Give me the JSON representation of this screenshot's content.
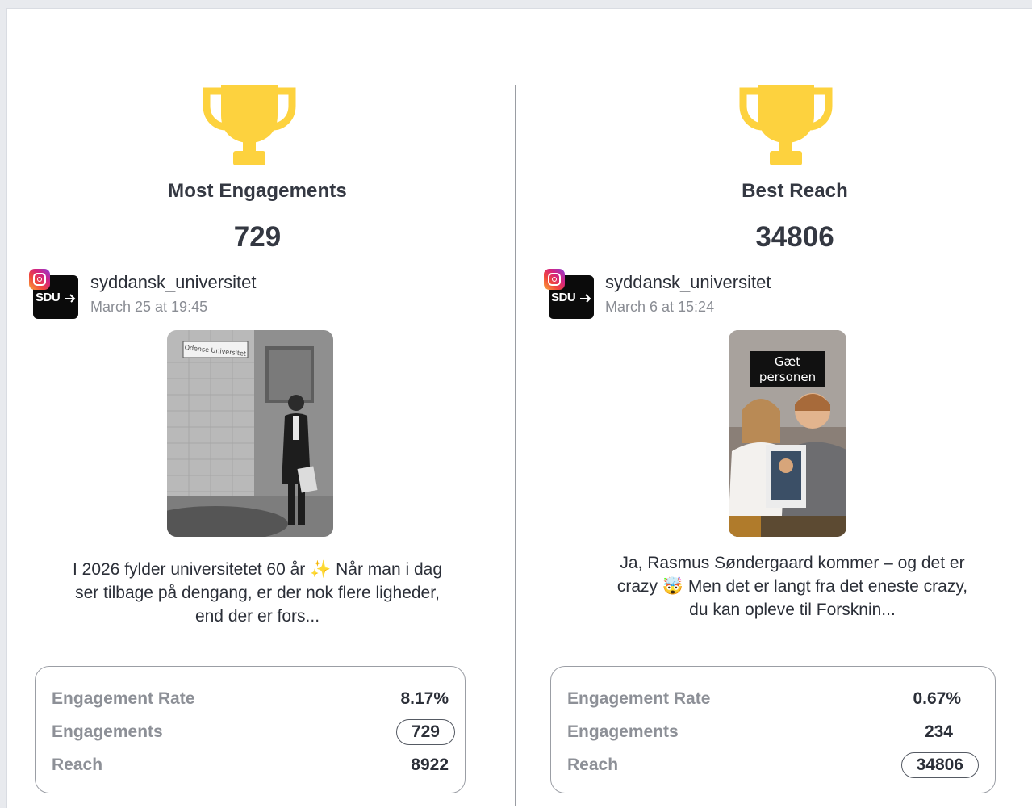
{
  "cards": [
    {
      "award_title": "Most Engagements",
      "award_value": "729",
      "account": "syddansk_universitet",
      "avatar_text": "SDU",
      "date": "March 25 at 19:45",
      "thumbnail_sign": "Odense Universitet",
      "caption": "I 2026 fylder universitetet 60 år ✨ Når man i dag ser tilbage på dengang, er der nok flere ligheder, end der er fors...",
      "stats": {
        "engagement_rate_label": "Engagement Rate",
        "engagement_rate": "8.17%",
        "engagements_label": "Engagements",
        "engagements": "729",
        "reach_label": "Reach",
        "reach": "8922"
      },
      "highlighted_stat": "engagements"
    },
    {
      "award_title": "Best Reach",
      "award_value": "34806",
      "account": "syddansk_universitet",
      "avatar_text": "SDU",
      "date": "March 6 at 15:24",
      "thumbnail_overlay": "Gæt personen",
      "caption": "Ja, Rasmus Søndergaard kommer – og det er crazy 🤯 Men det er langt fra det eneste crazy, du kan opleve til Forsknin...",
      "stats": {
        "engagement_rate_label": "Engagement Rate",
        "engagement_rate": "0.67%",
        "engagements_label": "Engagements",
        "engagements": "234",
        "reach_label": "Reach",
        "reach": "34806"
      },
      "highlighted_stat": "reach"
    }
  ],
  "icons": {
    "trophy": "trophy-icon",
    "instagram": "instagram-icon"
  },
  "colors": {
    "trophy": "#fdd23e",
    "text_dark": "#343842",
    "text_muted": "#8d9097"
  }
}
